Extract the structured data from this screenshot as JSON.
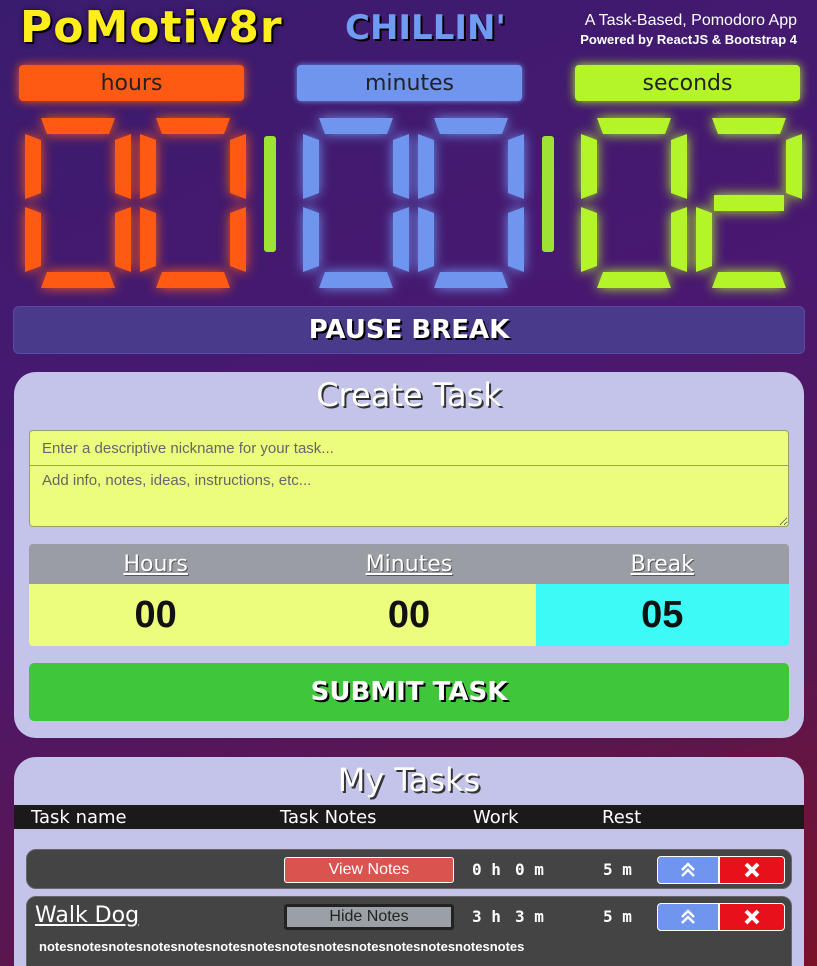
{
  "header": {
    "app_title": "PoMotiv8r",
    "status": "CHILLIN'",
    "tagline_1": "A Task-Based, Pomodoro App",
    "tagline_2": "Powered by ReactJS & Bootstrap 4"
  },
  "timer": {
    "labels": {
      "hours": "hours",
      "minutes": "minutes",
      "seconds": "seconds"
    },
    "hours": "00",
    "minutes": "00",
    "seconds": "02",
    "colors": {
      "hours": "#ff5a14",
      "minutes": "#6f95ef",
      "seconds": "#b4f52a",
      "colon": "#9fe332"
    }
  },
  "pause_label": "PAUSE BREAK",
  "create_task": {
    "title": "Create Task",
    "name_placeholder": "Enter a descriptive nickname for your task...",
    "notes_placeholder": "Add info, notes, ideas, instructions, etc...",
    "headers": {
      "hours": "Hours",
      "minutes": "Minutes",
      "break": "Break"
    },
    "values": {
      "hours": "00",
      "minutes": "00",
      "break": "05"
    },
    "submit_label": "SUBMIT TASK"
  },
  "my_tasks": {
    "title": "My Tasks",
    "columns": {
      "name": "Task name",
      "notes": "Task Notes",
      "work": "Work",
      "rest": "Rest"
    },
    "rows": [
      {
        "name": "",
        "notes_button": "View Notes",
        "work_h": "0 h",
        "work_m": "0 m",
        "rest": "5 m",
        "up_icon": "double-chevron-up-icon",
        "delete_icon": "close-x-icon"
      },
      {
        "name": "Walk Dog",
        "notes_button": "Hide Notes",
        "work_h": "3 h",
        "work_m": "3 m",
        "rest": "5 m",
        "notes": "notesnotesnotesnotesnotesnotesnotesnotesnotesnotesnotesnotesnotesnotes",
        "up_icon": "double-chevron-up-icon",
        "delete_icon": "close-x-icon"
      }
    ]
  }
}
